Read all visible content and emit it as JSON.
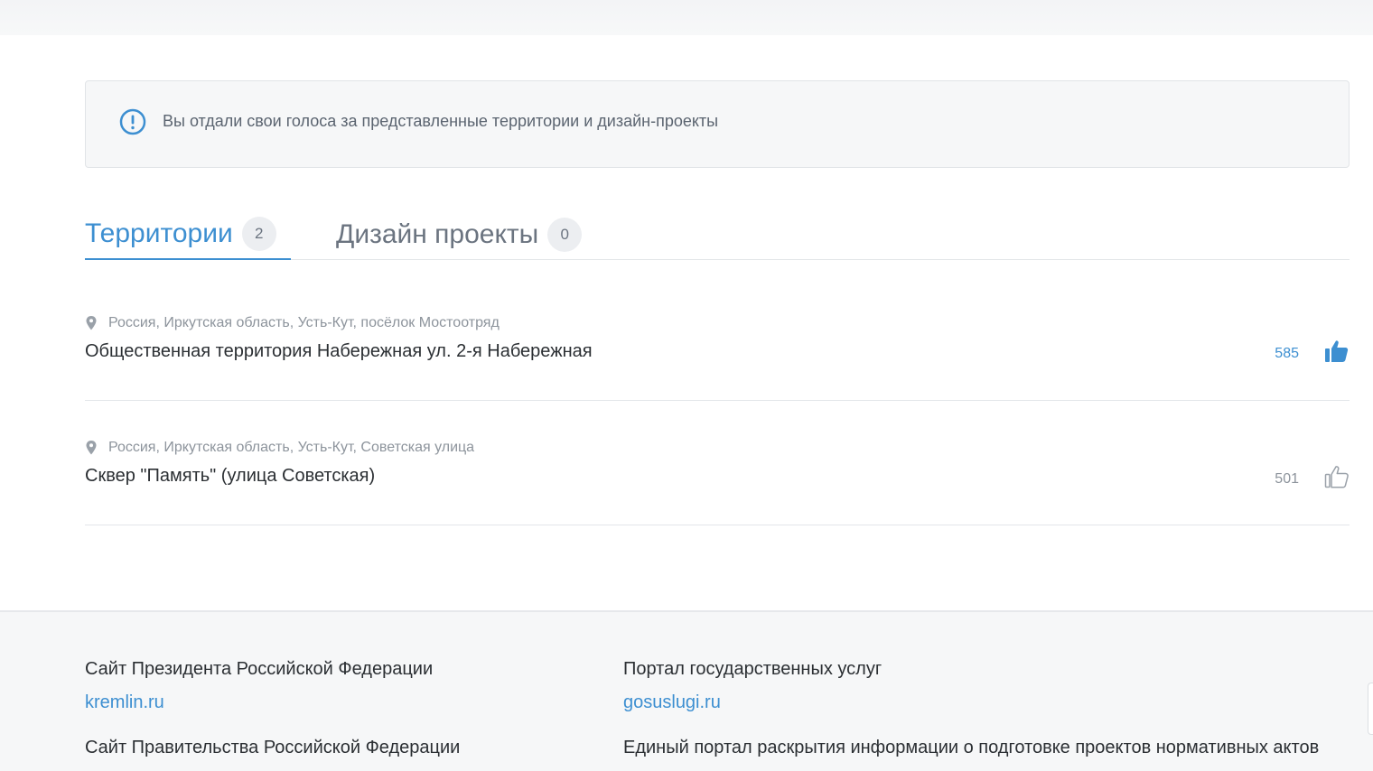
{
  "notice": {
    "text": "Вы отдали свои голоса за представленные территории и дизайн-проекты",
    "icon": "info-circle-icon",
    "icon_color": "#3d8fd1"
  },
  "tabs": [
    {
      "label": "Территории",
      "count": "2",
      "active": true
    },
    {
      "label": "Дизайн проекты",
      "count": "0",
      "active": false
    }
  ],
  "items": [
    {
      "address": "Россия, Иркутская область, Усть-Кут, посёлок Мостоотряд",
      "title": "Общественная территория Набережная ул. 2-я Набережная",
      "votes": "585",
      "voted": true
    },
    {
      "address": "Россия, Иркутская область, Усть-Кут, Советская улица",
      "title": "Сквер \"Память\" (улица Советская)",
      "votes": "501",
      "voted": false
    }
  ],
  "footer": {
    "col1": [
      {
        "title": "Сайт Президента Российской Федерации",
        "link": "kremlin.ru"
      },
      {
        "title": "Сайт Правительства Российской Федерации"
      }
    ],
    "col2": [
      {
        "title": "Портал государственных услуг",
        "link": "gosuslugi.ru"
      },
      {
        "title": "Единый портал раскрытия информации о подготовке проектов нормативных актов"
      }
    ]
  },
  "colors": {
    "accent": "#3d8fd1",
    "muted": "#8d949c",
    "text": "#2b2f33"
  }
}
